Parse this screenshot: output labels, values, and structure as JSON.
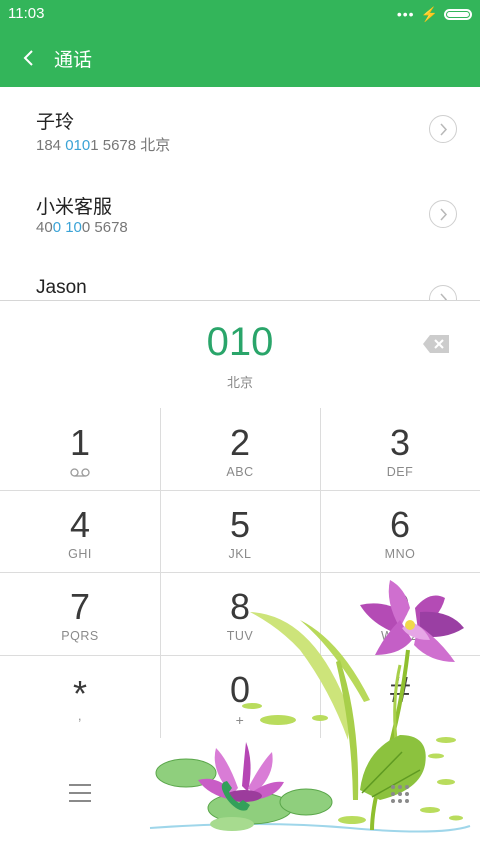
{
  "status_bar": {
    "time": "11:03",
    "dots": "•••",
    "bolt": "⚡"
  },
  "header": {
    "title": "通话"
  },
  "contacts": [
    {
      "name": "子玲",
      "number_parts": [
        "184 ",
        "010",
        "1 5678  北京"
      ]
    },
    {
      "name": "小米客服",
      "number_parts": [
        "40",
        "0 10",
        "0 5678"
      ]
    },
    {
      "name": "Jason",
      "number_parts": [
        "",
        "",
        ""
      ]
    }
  ],
  "dialer": {
    "dialed_number": "010",
    "location": "北京"
  },
  "keys": [
    {
      "digit": "1",
      "letters": ""
    },
    {
      "digit": "2",
      "letters": "ABC"
    },
    {
      "digit": "3",
      "letters": "DEF"
    },
    {
      "digit": "4",
      "letters": "GHI"
    },
    {
      "digit": "5",
      "letters": "JKL"
    },
    {
      "digit": "6",
      "letters": "MNO"
    },
    {
      "digit": "7",
      "letters": "PQRS"
    },
    {
      "digit": "8",
      "letters": "TUV"
    },
    {
      "digit": "9",
      "letters": "WXYZ"
    },
    {
      "digit": "*",
      "letters": ","
    },
    {
      "digit": "0",
      "letters": "+"
    },
    {
      "digit": "#",
      "letters": ""
    }
  ],
  "colors": {
    "accent": "#33b55a",
    "dialed": "#2aa56a",
    "highlight": "#3aa3d6"
  },
  "icons": {
    "back": "chevron-left-icon",
    "backspace": "backspace-icon",
    "voicemail": "voicemail-icon",
    "menu": "menu-icon",
    "call": "phone-icon",
    "keypad": "dialpad-icon"
  }
}
